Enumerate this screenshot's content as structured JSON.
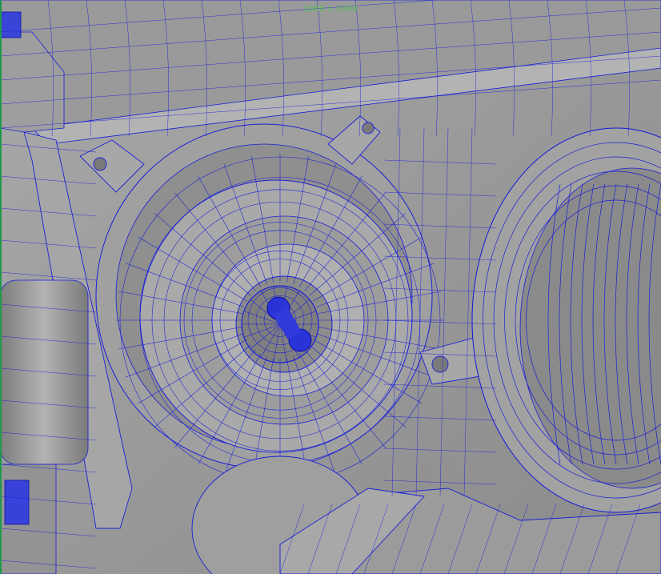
{
  "viewport": {
    "resolution_label": "1080 x 1080",
    "background_color": "#8e8e8e",
    "wire_color": "#1a1fd6",
    "surface_color": "#a3a3a3",
    "highlight_color": "#c4c4c4",
    "shadow_color": "#6f6f6f",
    "axis_color": "#1d9a4a",
    "label_color": "#4ec24e"
  }
}
